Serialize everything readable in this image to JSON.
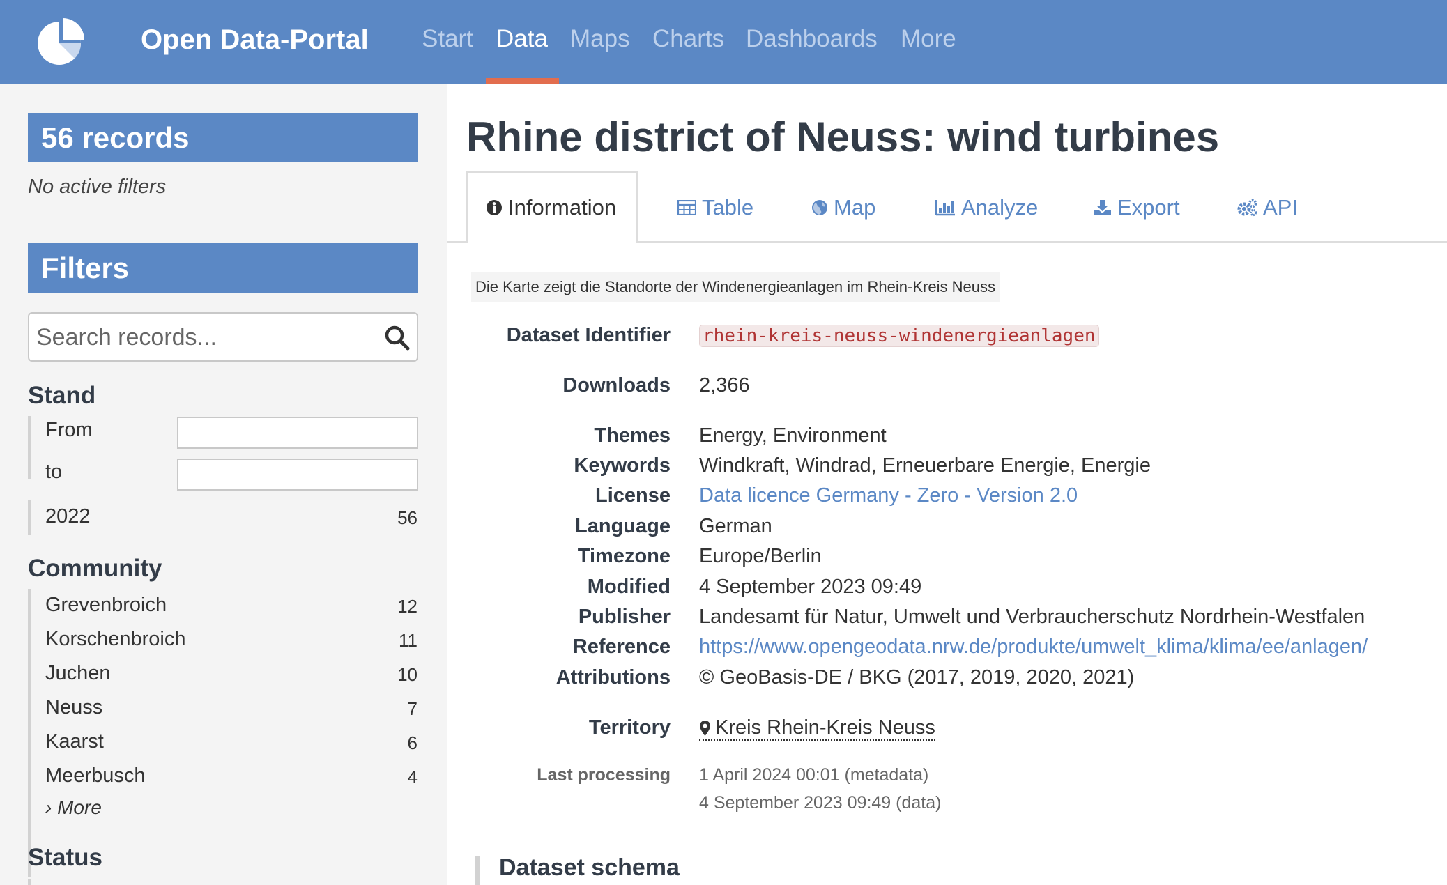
{
  "header": {
    "brand": "Open Data-Portal",
    "nav": [
      "Start",
      "Data",
      "Maps",
      "Charts",
      "Dashboards",
      "More"
    ],
    "active_nav": "Data",
    "colors": {
      "primary": "#5b88c5",
      "accent": "#e26d4e"
    }
  },
  "sidebar": {
    "records_label": "56 records",
    "no_filters": "No active filters",
    "filters_label": "Filters",
    "search_placeholder": "Search records...",
    "stand": {
      "title": "Stand",
      "from_label": "From",
      "to_label": "to",
      "items": [
        {
          "label": "2022",
          "count": "56"
        }
      ]
    },
    "community": {
      "title": "Community",
      "items": [
        {
          "label": "Grevenbroich",
          "count": "12"
        },
        {
          "label": "Korschenbroich",
          "count": "11"
        },
        {
          "label": "Juchen",
          "count": "10"
        },
        {
          "label": "Neuss",
          "count": "7"
        },
        {
          "label": "Kaarst",
          "count": "6"
        },
        {
          "label": "Meerbusch",
          "count": "4"
        }
      ],
      "more": "› More"
    },
    "status": {
      "title": "Status"
    }
  },
  "main": {
    "title": "Rhine district of Neuss: wind turbines",
    "tabs": [
      {
        "label": "Information",
        "icon": "info-circle-icon"
      },
      {
        "label": "Table",
        "icon": "table-icon"
      },
      {
        "label": "Map",
        "icon": "globe-icon"
      },
      {
        "label": "Analyze",
        "icon": "bar-chart-icon"
      },
      {
        "label": "Export",
        "icon": "download-icon"
      },
      {
        "label": "API",
        "icon": "cogs-icon"
      }
    ],
    "active_tab": "Information",
    "description": "Die Karte zeigt die Standorte der Windenergieanlagen im Rhein-Kreis Neuss",
    "metadata": {
      "identifier_label": "Dataset Identifier",
      "identifier": "rhein-kreis-neuss-windenergieanlagen",
      "downloads_label": "Downloads",
      "downloads": "2,366",
      "themes_label": "Themes",
      "themes": "Energy, Environment",
      "keywords_label": "Keywords",
      "keywords": "Windkraft, Windrad, Erneuerbare Energie, Energie",
      "license_label": "License",
      "license": "Data licence Germany - Zero - Version 2.0",
      "language_label": "Language",
      "language": "German",
      "timezone_label": "Timezone",
      "timezone": "Europe/Berlin",
      "modified_label": "Modified",
      "modified": "4 September 2023 09:49",
      "publisher_label": "Publisher",
      "publisher": "Landesamt für Natur, Umwelt und Verbraucherschutz Nordrhein-Westfalen",
      "reference_label": "Reference",
      "reference": "https://www.opengeodata.nrw.de/produkte/umwelt_klima/klima/ee/anlagen/",
      "attributions_label": "Attributions",
      "attributions": "© GeoBasis-DE / BKG (2017, 2019, 2020, 2021)",
      "territory_label": "Territory",
      "territory": "Kreis Rhein-Kreis Neuss",
      "last_processing_label": "Last processing",
      "last_processing_metadata": "1 April 2024 00:01 (metadata)",
      "last_processing_data": "4 September 2023 09:49 (data)"
    },
    "schema_title": "Dataset schema"
  }
}
